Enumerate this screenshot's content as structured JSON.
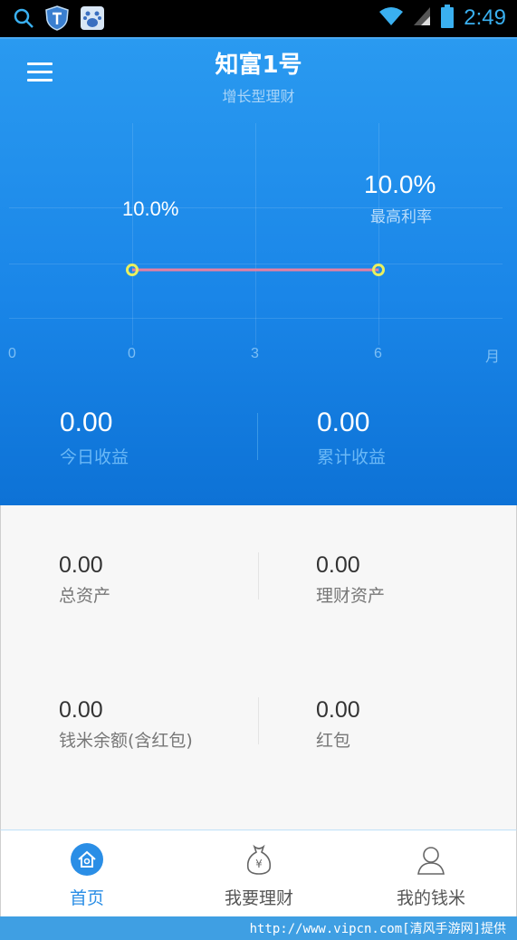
{
  "status_bar": {
    "time": "2:49"
  },
  "header": {
    "title": "知富1号",
    "subtitle": "增长型理财",
    "menu_icon": "hamburger-menu-icon"
  },
  "rate_chart": {
    "left_label": "10.0%",
    "right_value": "10.0%",
    "right_label": "最高利率",
    "ticks": [
      "0",
      "0",
      "3",
      "6",
      "月"
    ]
  },
  "chart_data": {
    "type": "line",
    "x": [
      0,
      6
    ],
    "values": [
      10.0,
      10.0
    ],
    "xlabel": "月",
    "xticks": [
      "0",
      "0",
      "3",
      "6"
    ],
    "line_color": "#e87fa0",
    "marker_color": "#e8f060"
  },
  "earnings": {
    "today_value": "0.00",
    "today_label": "今日收益",
    "total_value": "0.00",
    "total_label": "累计收益"
  },
  "assets": {
    "total_value": "0.00",
    "total_label": "总资产",
    "fin_value": "0.00",
    "fin_label": "理财资产",
    "balance_value": "0.00",
    "balance_label": "钱米余额(含红包)",
    "redpacket_value": "0.00",
    "redpacket_label": "红包"
  },
  "bottom_nav": [
    {
      "label": "首页",
      "icon": "home-icon",
      "active": true
    },
    {
      "label": "我要理财",
      "icon": "money-bag-icon",
      "active": false
    },
    {
      "label": "我的钱米",
      "icon": "user-profile-icon",
      "active": false
    }
  ],
  "watermark": "http://www.vipcn.com[清风手游网]提供",
  "colors": {
    "accent": "#2a8ee6",
    "hero_top": "#2a9af0",
    "hero_bottom": "#0d72d6"
  }
}
